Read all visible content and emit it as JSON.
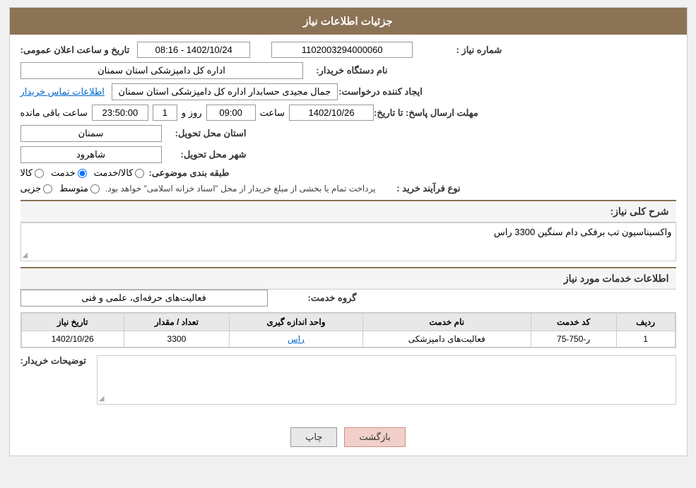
{
  "header": {
    "title": "جزئیات اطلاعات نیاز"
  },
  "fields": {
    "shomare_niaz_label": "شماره نیاز :",
    "shomare_niaz_value": "1102003294000060",
    "nam_dastgah_label": "نام دستگاه خریدار:",
    "nam_dastgah_value": "اداره کل دامپزشکی استان سمنان",
    "ijad_konande_label": "ایجاد کننده درخواست:",
    "ijad_konande_value": "جمال مجیدی حسابدار اداره کل دامپزشکی استان سمنان",
    "ettelaat_tamas_label": "اطلاعات تماس خریدار",
    "mohlat_label": "مهلت ارسال پاسخ: تا تاریخ:",
    "mohlat_date": "1402/10/26",
    "mohlat_saat_label": "ساعت",
    "mohlat_saat": "09:00",
    "mohlat_roz_label": "روز و",
    "mohlat_roz": "1",
    "mohlat_time2": "23:50:00",
    "mohlat_baqi_label": "ساعت باقی مانده",
    "tarikh_va_saat_label": "تاریخ و ساعت اعلان عمومی:",
    "tarikh_va_saat_value": "1402/10/24 - 08:16",
    "ostan_label": "استان محل تحویل:",
    "ostan_value": "سمنان",
    "shahr_label": "شهر محل تحویل:",
    "shahr_value": "شاهرود",
    "tabaqe_label": "طبقه بندی موضوعی:",
    "tabaqe_kala": "کالا",
    "tabaqe_khadamat": "خدمت",
    "tabaqe_kala_khadamat": "کالا/خدمت",
    "tabaqe_selected": "khadamat",
    "nove_farayand_label": "نوع فرآیند خرید :",
    "nove_jozi": "جزیی",
    "nove_motovasset": "متوسط",
    "nove_note": "پرداخت تمام یا بخشی از مبلغ خریدار از محل \"اسناد خزانه اسلامی\" خواهد بود.",
    "sharh_label": "شرح کلی نیاز:",
    "sharh_value": "واکسیناسیون تب برفکی دام سنگین 3300 راس",
    "khadamat_label": "اطلاعات خدمات مورد نیاز",
    "goroh_label": "گروه خدمت:",
    "goroh_value": "فعالیت‌های حرفه‌ای، علمی و فنی"
  },
  "table": {
    "headers": [
      "ردیف",
      "کد خدمت",
      "نام خدمت",
      "واحد اندازه گیری",
      "تعداد / مقدار",
      "تاریخ نیاز"
    ],
    "rows": [
      {
        "radif": "1",
        "kod": "ر-750-75",
        "nam": "فعالیت‌های دامپزشکی",
        "vahed": "راس",
        "tedad": "3300",
        "tarikh": "1402/10/26"
      }
    ]
  },
  "description": {
    "label": "توضیحات خریدار:",
    "value": ""
  },
  "buttons": {
    "print_label": "چاپ",
    "back_label": "بازگشت"
  }
}
